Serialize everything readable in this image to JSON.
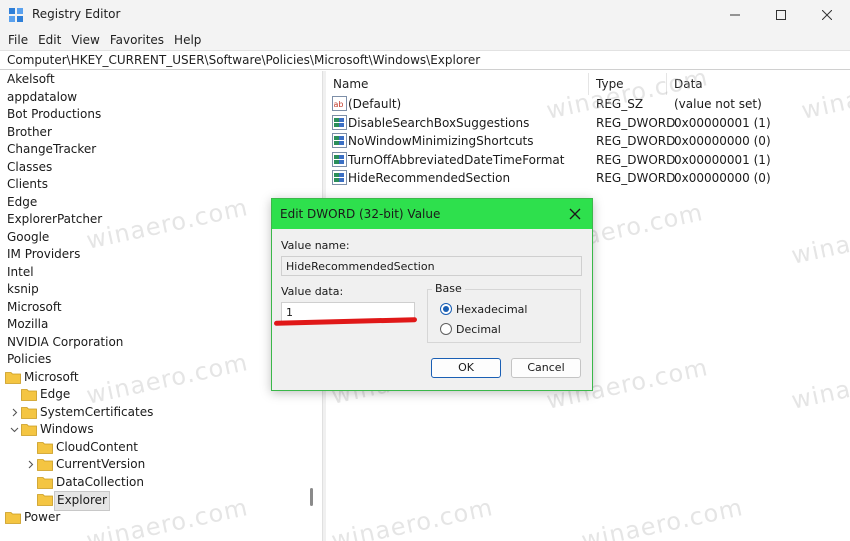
{
  "window": {
    "title": "Registry Editor"
  },
  "menu": [
    "File",
    "Edit",
    "View",
    "Favorites",
    "Help"
  ],
  "address": "Computer\\HKEY_CURRENT_USER\\Software\\Policies\\Microsoft\\Windows\\Explorer",
  "tree": [
    {
      "label": "Akelsoft",
      "level": 0,
      "folder": false,
      "expander": "none"
    },
    {
      "label": "appdatalow",
      "level": 0,
      "folder": false,
      "expander": "none"
    },
    {
      "label": "Bot Productions",
      "level": 0,
      "folder": false,
      "expander": "none"
    },
    {
      "label": "Brother",
      "level": 0,
      "folder": false,
      "expander": "none"
    },
    {
      "label": "ChangeTracker",
      "level": 0,
      "folder": false,
      "expander": "none"
    },
    {
      "label": "Classes",
      "level": 0,
      "folder": false,
      "expander": "none"
    },
    {
      "label": "Clients",
      "level": 0,
      "folder": false,
      "expander": "none"
    },
    {
      "label": "Edge",
      "level": 0,
      "folder": false,
      "expander": "none"
    },
    {
      "label": "ExplorerPatcher",
      "level": 0,
      "folder": false,
      "expander": "none"
    },
    {
      "label": "Google",
      "level": 0,
      "folder": false,
      "expander": "none"
    },
    {
      "label": "IM Providers",
      "level": 0,
      "folder": false,
      "expander": "none"
    },
    {
      "label": "Intel",
      "level": 0,
      "folder": false,
      "expander": "none"
    },
    {
      "label": "ksnip",
      "level": 0,
      "folder": false,
      "expander": "none"
    },
    {
      "label": "Microsoft",
      "level": 0,
      "folder": false,
      "expander": "none"
    },
    {
      "label": "Mozilla",
      "level": 0,
      "folder": false,
      "expander": "none"
    },
    {
      "label": "NVIDIA Corporation",
      "level": 0,
      "folder": false,
      "expander": "none"
    },
    {
      "label": "Policies",
      "level": 0,
      "folder": false,
      "expander": "none"
    },
    {
      "label": "Microsoft",
      "level": 1,
      "folder": true,
      "expander": "none"
    },
    {
      "label": "Edge",
      "level": 2,
      "folder": true,
      "expander": "none"
    },
    {
      "label": "SystemCertificates",
      "level": 2,
      "folder": true,
      "expander": "collapsed"
    },
    {
      "label": "Windows",
      "level": 2,
      "folder": true,
      "expander": "expanded"
    },
    {
      "label": "CloudContent",
      "level": 3,
      "folder": true,
      "expander": "none"
    },
    {
      "label": "CurrentVersion",
      "level": 3,
      "folder": true,
      "expander": "collapsed"
    },
    {
      "label": "DataCollection",
      "level": 3,
      "folder": true,
      "expander": "none"
    },
    {
      "label": "Explorer",
      "level": 3,
      "folder": true,
      "expander": "none",
      "selected": true
    },
    {
      "label": "Power",
      "level": 1,
      "folder": true,
      "expander": "none"
    }
  ],
  "columns": {
    "name": "Name",
    "type": "Type",
    "data": "Data"
  },
  "values": [
    {
      "name": "(Default)",
      "type": "REG_SZ",
      "data": "(value not set)",
      "icon": "string-value-icon"
    },
    {
      "name": "DisableSearchBoxSuggestions",
      "type": "REG_DWORD",
      "data": "0x00000001 (1)",
      "icon": "binary-value-icon"
    },
    {
      "name": "NoWindowMinimizingShortcuts",
      "type": "REG_DWORD",
      "data": "0x00000000 (0)",
      "icon": "binary-value-icon"
    },
    {
      "name": "TurnOffAbbreviatedDateTimeFormat",
      "type": "REG_DWORD",
      "data": "0x00000001 (1)",
      "icon": "binary-value-icon"
    },
    {
      "name": "HideRecommendedSection",
      "type": "REG_DWORD",
      "data": "0x00000000 (0)",
      "icon": "binary-value-icon"
    }
  ],
  "dialog": {
    "title": "Edit DWORD (32-bit) Value",
    "value_name_label": "Value name:",
    "value_name": "HideRecommendedSection",
    "value_data_label": "Value data:",
    "value_data": "1",
    "base_label": "Base",
    "radio_hex": "Hexadecimal",
    "radio_dec": "Decimal",
    "ok": "OK",
    "cancel": "Cancel"
  },
  "watermark": "winaero.com",
  "colors": {
    "dialog_title_bg": "#2ee04d",
    "highlight_underline": "#e01818",
    "folder": "#f4c542"
  }
}
